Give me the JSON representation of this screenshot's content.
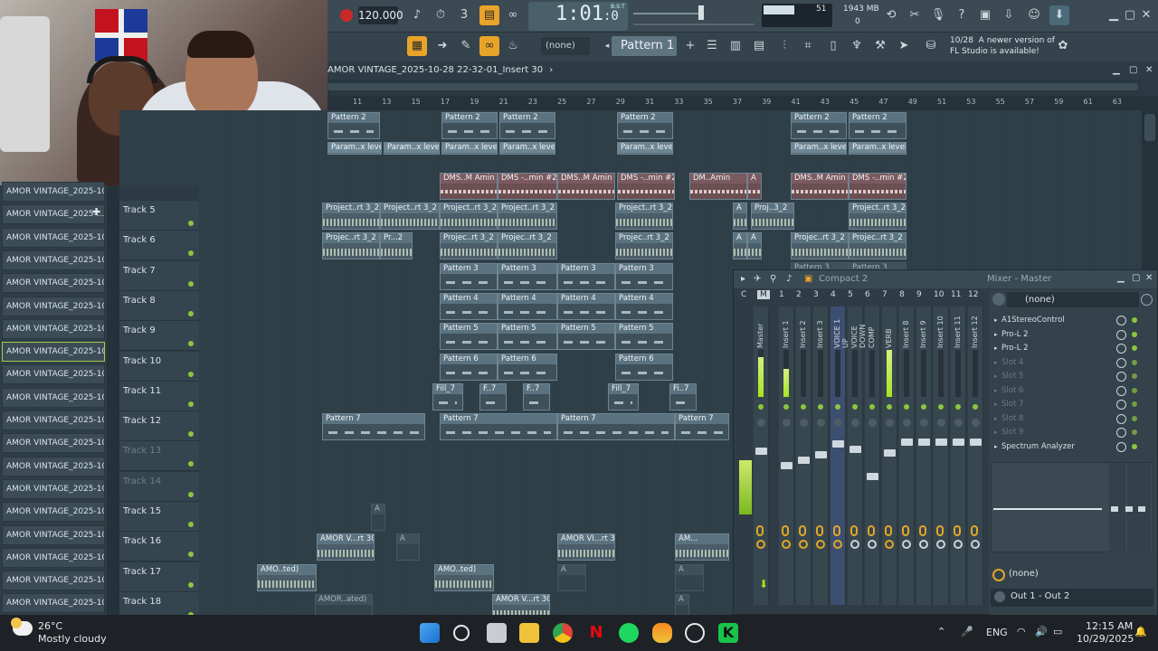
{
  "toolbar": {
    "tempo": "120.000",
    "time": "1:01",
    "time_sub": ":0",
    "bst_label": "B:S:T",
    "cpu_value": "51",
    "memory": "1943 MB",
    "memory_sub": "0",
    "pattern_label": "Pattern 1",
    "none_label": "(none)",
    "update_count": "10/28",
    "update_line1": "A newer version of",
    "update_line2": "FL Studio is available!"
  },
  "playlist": {
    "title": "AMOR VINTAGE_2025-10-28 22-32-01_Insert 30",
    "ruler": [
      "11",
      "13",
      "15",
      "17",
      "19",
      "21",
      "23",
      "25",
      "27",
      "29",
      "31",
      "33",
      "35",
      "37",
      "39",
      "41",
      "43",
      "45",
      "47",
      "49",
      "51",
      "53",
      "55",
      "57",
      "59",
      "61",
      "63"
    ]
  },
  "browser": {
    "items": [
      "AMOR VINTAGE_2025-10-...",
      "AMOR VINTAGE_2025-...",
      "AMOR VINTAGE_2025-10-...",
      "AMOR VINTAGE_2025-10-...",
      "AMOR VINTAGE_2025-10-...",
      "AMOR VINTAGE_2025-10-...",
      "AMOR VINTAGE_2025-10-...",
      "AMOR VINTAGE_2025-10-...",
      "AMOR VINTAGE_2025-10-...",
      "AMOR VINTAGE_2025-10-...",
      "AMOR VINTAGE_2025-10-...",
      "AMOR VINTAGE_2025-10-...",
      "AMOR VINTAGE_2025-10-...",
      "AMOR VINTAGE_2025-10-...",
      "AMOR VINTAGE_2025-10-...",
      "AMOR VINTAGE_2025-10-...",
      "AMOR VINTAGE_2025-10-...",
      "AMOR VINTAGE_2025-10-...",
      "AMOR VINTAGE_2025-10-..."
    ]
  },
  "tracks": [
    "Track 5",
    "Track 6",
    "Track 7",
    "Track 8",
    "Track 9",
    "Track 10",
    "Track 11",
    "Track 12",
    "Track 13",
    "Track 14",
    "Track 15",
    "Track 16",
    "Track 17",
    "Track 18"
  ],
  "clips": {
    "pattern2": "Pattern 2",
    "param": "Param..x level",
    "dms1": "DMS..M Amin",
    "dms2": "DMS -..min #2",
    "dms3": "DM..Amin",
    "project": "Project..rt 3_2",
    "projec": "Projec..rt 3_2",
    "proj": "Proj..3_2",
    "pr": "Pr...2",
    "pattern3": "Pattern 3",
    "pattern4": "Pattern 4",
    "pattern5": "Pattern 5",
    "pattern6": "Pattern 6",
    "fill": "Fill_7",
    "f": "F..7",
    "fi": "Fi..7",
    "pattern7": "Pattern 7",
    "amorv": "AMOR V...rt 30",
    "amorvi": "AMOR VI...rt 30",
    "am": "AM...",
    "amo": "AMO..ted)",
    "amor_ated": "AMOR..ated)",
    "amor_rt30": "AMOR V...rt 30",
    "xa": "A"
  },
  "mixer": {
    "title": "Mixer - Master",
    "compact": "Compact 2",
    "preset": "(none)",
    "strips": [
      "Master",
      "Insert 1",
      "Insert 2",
      "Insert 3",
      "VOICE 1 UP",
      "VOICE DOWN",
      "COMP",
      "VERB",
      "Insert 8",
      "Insert 9",
      "Insert 10",
      "Insert 11",
      "Insert 12"
    ],
    "numbers": [
      "C",
      "M",
      "1",
      "2",
      "3",
      "4",
      "5",
      "6",
      "7",
      "8",
      "9",
      "10",
      "11",
      "12"
    ],
    "slots": [
      "A1StereoControl",
      "Pro-L 2",
      "Pro-L 2",
      "Slot 4",
      "Slot 5",
      "Slot 6",
      "Slot 7",
      "Slot 8",
      "Slot 9",
      "Spectrum Analyzer"
    ],
    "bottom_none": "(none)",
    "output": "Out 1 - Out 2"
  },
  "taskbar": {
    "temp": "26°C",
    "weather": "Mostly cloudy",
    "lang": "ENG",
    "time": "12:15 AM",
    "date": "10/29/2025"
  }
}
